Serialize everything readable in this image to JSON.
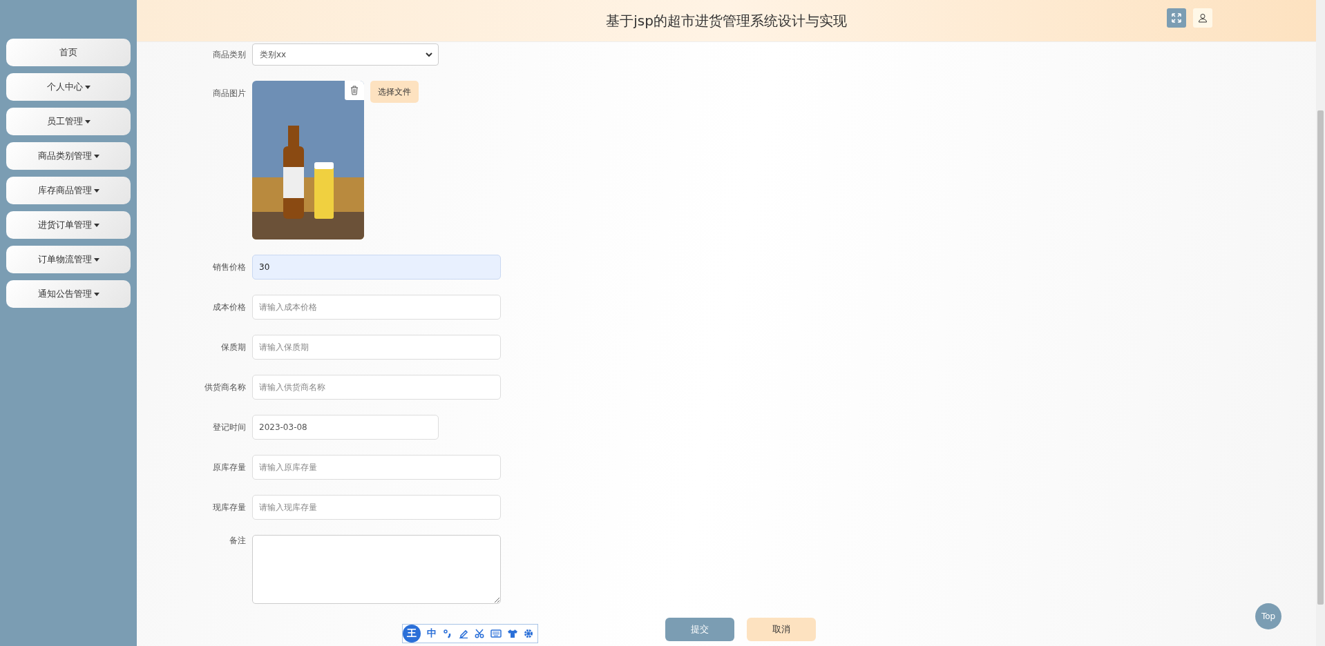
{
  "header": {
    "title": "基于jsp的超市进货管理系统设计与实现"
  },
  "sidebar": {
    "items": [
      {
        "label": "首页",
        "kind": "link"
      },
      {
        "label": "个人中心",
        "kind": "dropdown"
      },
      {
        "label": "员工管理",
        "kind": "dropdown"
      },
      {
        "label": "商品类别管理",
        "kind": "dropdown"
      },
      {
        "label": "库存商品管理",
        "kind": "dropdown"
      },
      {
        "label": "进货订单管理",
        "kind": "dropdown"
      },
      {
        "label": "订单物流管理",
        "kind": "dropdown"
      },
      {
        "label": "通知公告管理",
        "kind": "dropdown"
      }
    ]
  },
  "form": {
    "fields": [
      {
        "label": "商品类别",
        "kind": "select",
        "value": "类别xx"
      },
      {
        "label": "商品图片",
        "kind": "image",
        "button": "选择文件"
      },
      {
        "label": "销售价格",
        "kind": "text",
        "value": "30",
        "focused": true
      },
      {
        "label": "成本价格",
        "kind": "text",
        "placeholder": "请输入成本价格",
        "focused": false
      },
      {
        "label": "保质期",
        "kind": "text",
        "placeholder": "请输入保质期",
        "focused": false
      },
      {
        "label": "供货商名称",
        "kind": "text",
        "placeholder": "请输入供货商名称",
        "focused": false
      },
      {
        "label": "登记时间",
        "kind": "date",
        "value": "2023-03-08"
      },
      {
        "label": "原库存量",
        "kind": "text",
        "placeholder": "请输入原库存量",
        "focused": false
      },
      {
        "label": "现库存量",
        "kind": "text",
        "placeholder": "请输入现库存量",
        "focused": false
      },
      {
        "label": "备注",
        "kind": "textarea"
      }
    ],
    "buttons": [
      {
        "label": "提交",
        "kind": "primary"
      },
      {
        "label": "取消",
        "kind": "secondary"
      }
    ]
  },
  "ime_toolbar": {
    "logo": "王",
    "mode": "中"
  },
  "top_button": "Top"
}
